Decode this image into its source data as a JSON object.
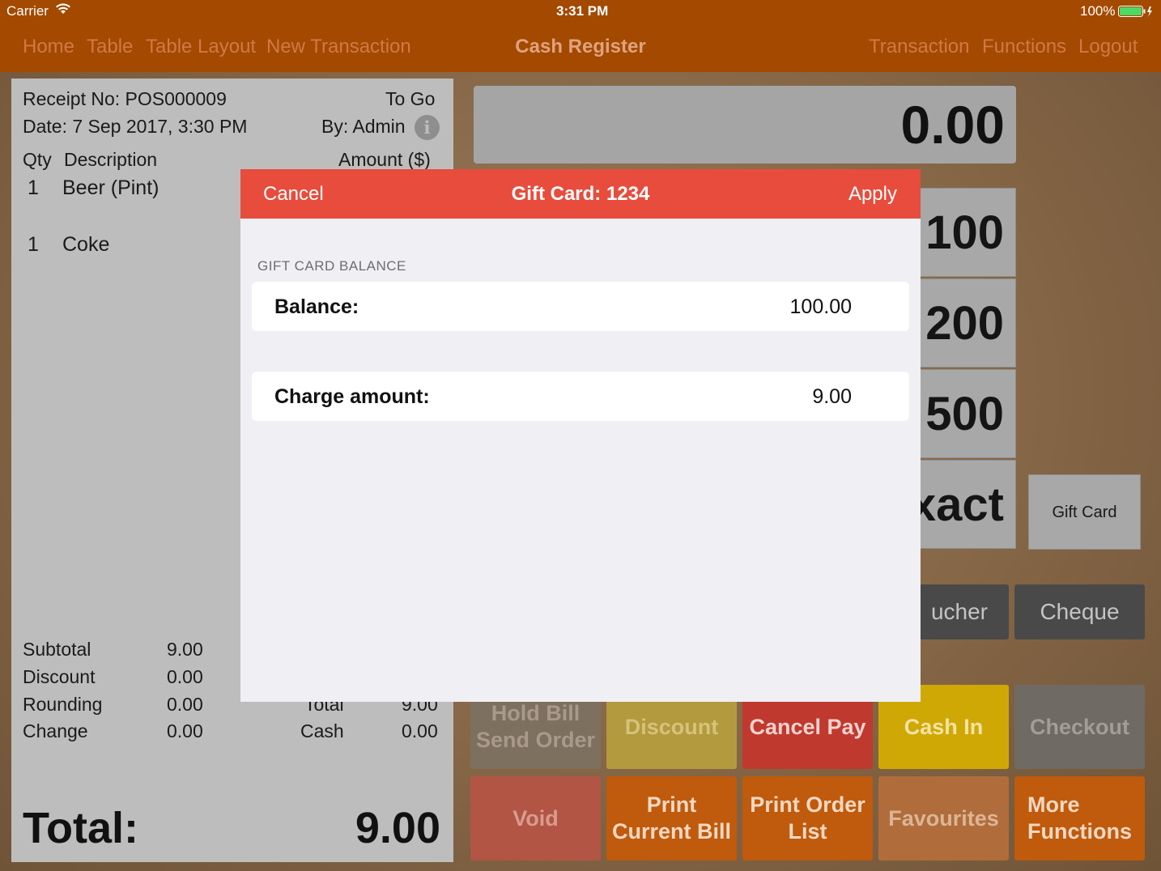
{
  "status_bar": {
    "carrier": "Carrier",
    "time": "3:31 PM",
    "battery": "100%"
  },
  "nav": {
    "left_links": [
      "Home",
      "Table",
      "Table Layout",
      "New Transaction"
    ],
    "title": "Cash Register",
    "right_links": [
      "Transaction",
      "Functions",
      "Logout"
    ]
  },
  "receipt": {
    "receipt_no": "Receipt No: POS000009",
    "order_type": "To Go",
    "date": "Date: 7 Sep 2017, 3:30 PM",
    "by": "By: Admin",
    "col_qty": "Qty",
    "col_desc": "Description",
    "col_amount": "Amount ($)",
    "items": [
      {
        "qty": "1",
        "desc": "Beer (Pint)"
      },
      {
        "qty": "1",
        "desc": "Coke"
      }
    ],
    "summary": [
      {
        "label": "Subtotal",
        "value": "9.00"
      },
      {
        "label": "Discount",
        "value": "0.00"
      },
      {
        "label": "Rounding",
        "value": "0.00"
      },
      {
        "label": "Change",
        "value": "0.00"
      }
    ],
    "right_summary": [
      {
        "label": "Total",
        "value": "9.00"
      },
      {
        "label": "Cash",
        "value": "0.00"
      }
    ],
    "total_label": "Total:",
    "total_value": "9.00"
  },
  "amount_display": "0.00",
  "cash_tiles": [
    "100",
    "200",
    "500",
    "xact"
  ],
  "gift_card_button": "Gift Card",
  "payment_buttons": [
    "ucher",
    "Cheque"
  ],
  "function_buttons": {
    "row1": [
      "Hold Bill\nSend Order",
      "Discount",
      "Cancel Pay",
      "Cash In",
      "Checkout"
    ],
    "row2": [
      "Void",
      "Print\nCurrent Bill",
      "Print Order\nList",
      "Favourites",
      "More\nFunctions"
    ]
  },
  "modal": {
    "cancel": "Cancel",
    "title": "Gift Card: 1234",
    "apply": "Apply",
    "section_label": "GIFT CARD BALANCE",
    "balance_label": "Balance:",
    "balance_value": "100.00",
    "charge_label": "Charge amount:",
    "charge_value": "9.00"
  },
  "colors": {
    "nav_bg": "#a34900",
    "modal_header": "#e84c3c",
    "receipt_bg": "#bdbdbd"
  }
}
